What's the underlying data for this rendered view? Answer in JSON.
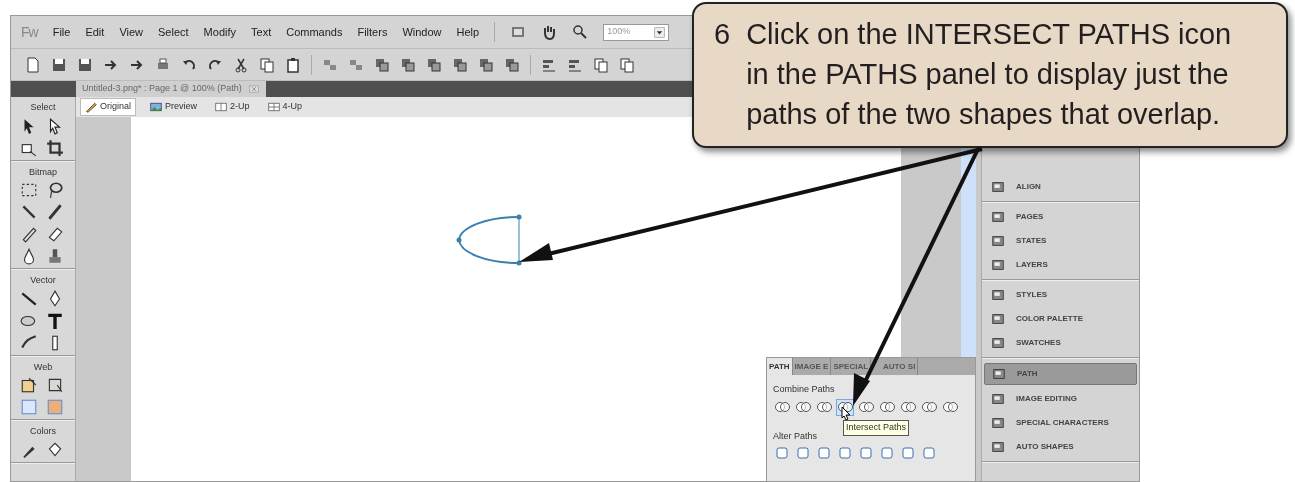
{
  "menu": {
    "logo": "Fw",
    "items": [
      "File",
      "Edit",
      "View",
      "Select",
      "Modify",
      "Text",
      "Commands",
      "Filters",
      "Window",
      "Help"
    ],
    "zoom": "100%"
  },
  "document_tab": {
    "title": "Untitled-3.png* : Page 1 @ 100% (Path)"
  },
  "view_tabs": [
    {
      "label": "Original",
      "selected": true
    },
    {
      "label": "Preview",
      "selected": false
    },
    {
      "label": "2-Up",
      "selected": false
    },
    {
      "label": "4-Up",
      "selected": false
    }
  ],
  "tools": [
    {
      "title": "Select"
    },
    {
      "title": "Bitmap"
    },
    {
      "title": "Vector"
    },
    {
      "title": "Web"
    },
    {
      "title": "Colors"
    }
  ],
  "dock": [
    [
      {
        "label": "ALIGN",
        "selected": false
      }
    ],
    [
      {
        "label": "PAGES",
        "selected": false
      },
      {
        "label": "STATES",
        "selected": false
      },
      {
        "label": "LAYERS",
        "selected": false
      }
    ],
    [
      {
        "label": "STYLES",
        "selected": false
      },
      {
        "label": "COLOR PALETTE",
        "selected": false
      },
      {
        "label": "SWATCHES",
        "selected": false
      }
    ],
    [
      {
        "label": "PATH",
        "selected": true
      },
      {
        "label": "IMAGE EDITING",
        "selected": false
      },
      {
        "label": "SPECIAL CHARACTERS",
        "selected": false
      },
      {
        "label": "AUTO SHAPES",
        "selected": false
      }
    ]
  ],
  "path_panel": {
    "tabs": [
      {
        "label": "PATH",
        "selected": true
      },
      {
        "label": "IMAGE E",
        "selected": false
      },
      {
        "label": "SPECIAL",
        "selected": false
      },
      {
        "label": "AUTO SI",
        "selected": false
      }
    ],
    "combine_label": "Combine Paths",
    "combine_buttons": [
      {
        "highlighted": false
      },
      {
        "highlighted": false
      },
      {
        "highlighted": false
      },
      {
        "highlighted": true
      },
      {
        "highlighted": false
      },
      {
        "highlighted": false
      },
      {
        "highlighted": false
      },
      {
        "highlighted": false
      },
      {
        "highlighted": false
      }
    ],
    "tooltip": "Intersect Paths",
    "alter_label": "Alter Paths"
  },
  "callout": {
    "step": "6",
    "text": "Click on the INTERSECT PATHS icon in the PATHS panel to display just the paths of the two shapes that overlap."
  }
}
